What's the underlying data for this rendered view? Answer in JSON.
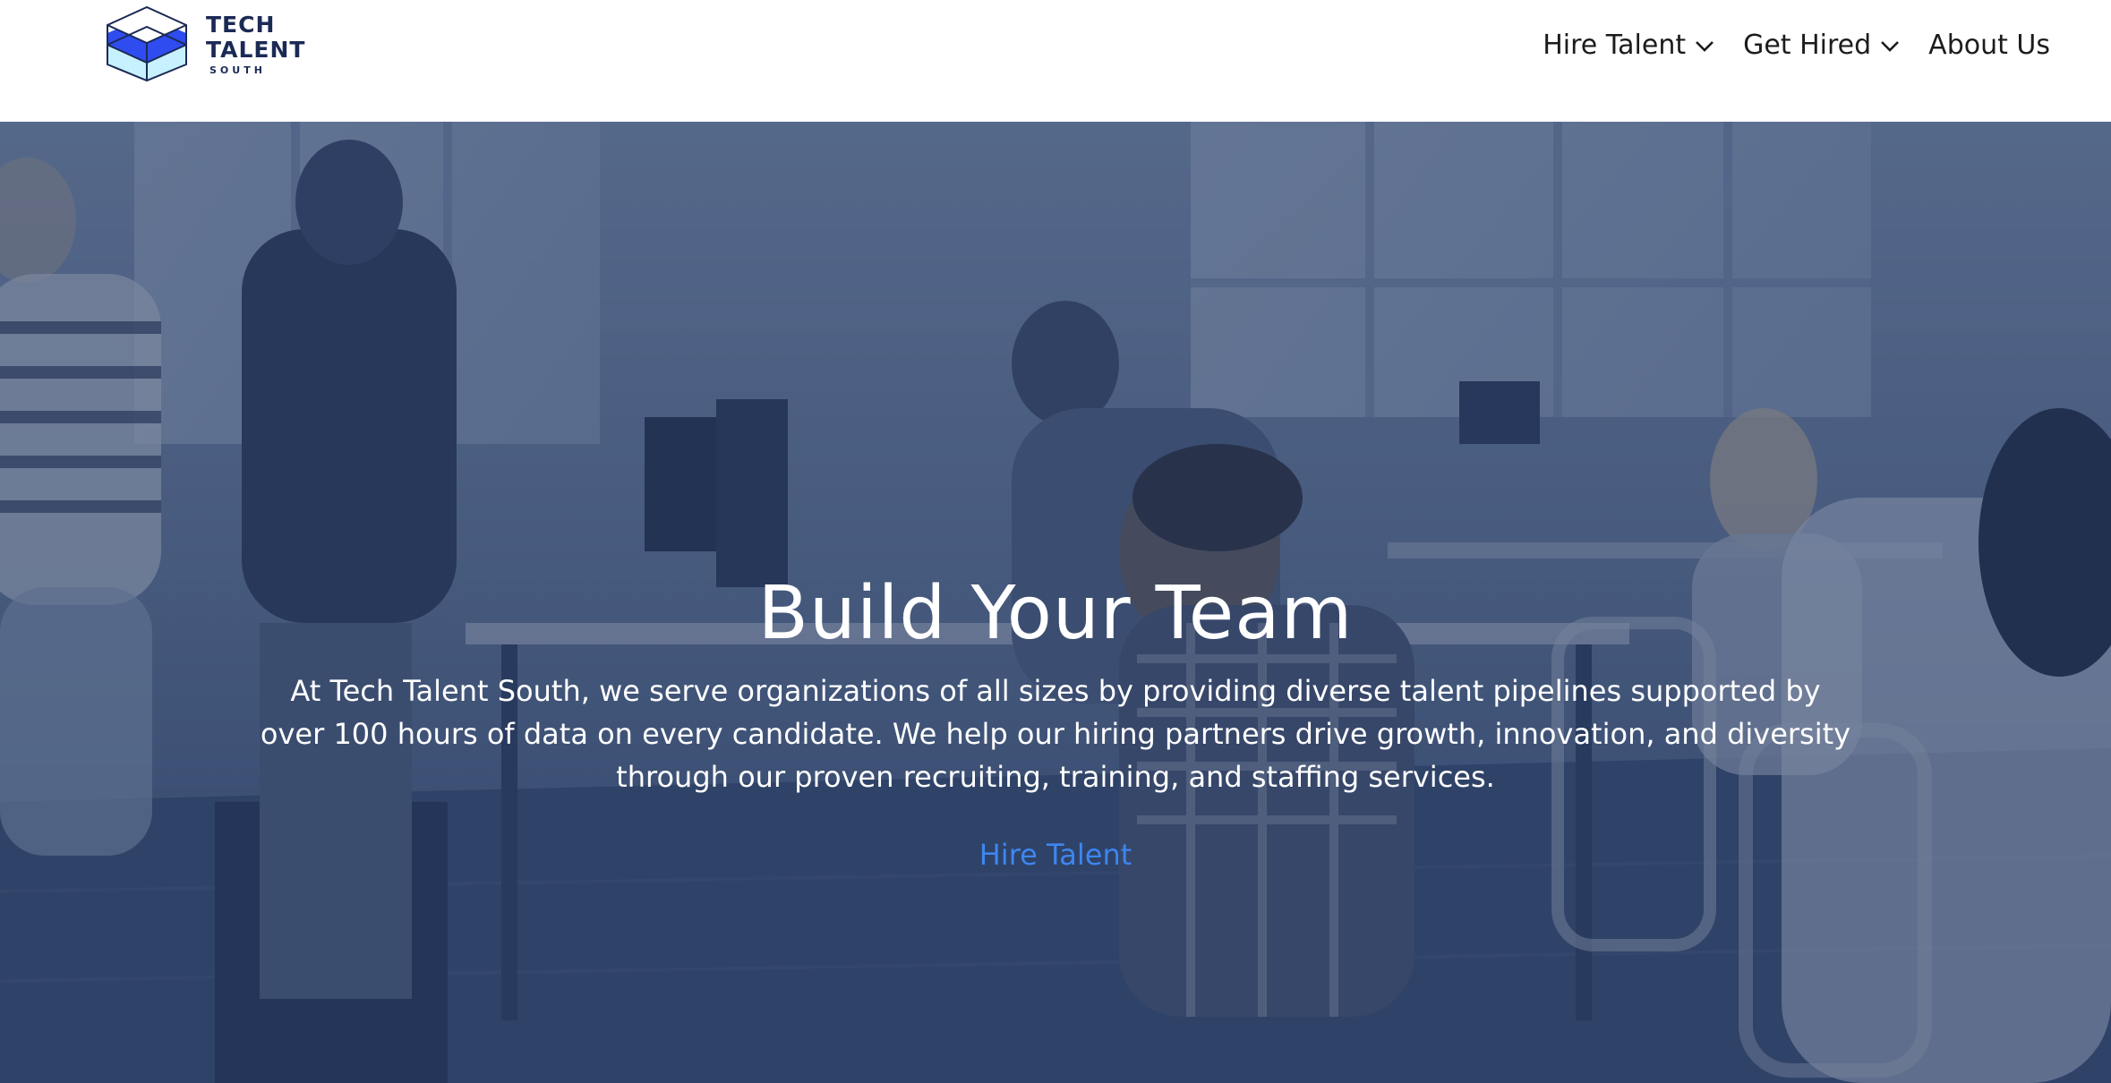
{
  "brand": {
    "line1": "TECH",
    "line2": "TALENT",
    "line3": "SOUTH",
    "colors": {
      "navy": "#1b2a55",
      "blue": "#2f4cf0",
      "light_cyan": "#c7f1ff"
    }
  },
  "nav": {
    "items": [
      {
        "label": "Hire Talent",
        "icon": "chevron-down-icon"
      },
      {
        "label": "Get Hired",
        "icon": "chevron-down-icon"
      },
      {
        "label": "About Us"
      }
    ]
  },
  "hero": {
    "title": "Build Your Team",
    "description": "At Tech Talent South, we serve organizations of all sizes by providing diverse talent pipelines supported by over 100 hours of data on every candidate. We help our hiring partners drive growth, innovation, and diversity through our proven recruiting, training, and staffing services.",
    "cta_label": "Hire Talent",
    "overlay_color": "#2b4270",
    "cta_color": "#3d86f0"
  }
}
